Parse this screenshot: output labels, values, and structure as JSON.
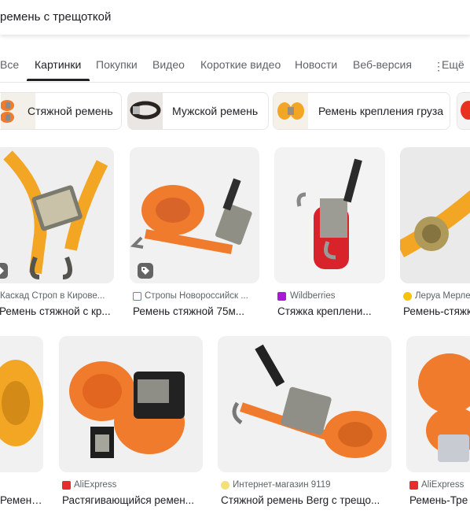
{
  "search": {
    "query": "ремень с трещоткой"
  },
  "tabs": [
    {
      "label": "Все"
    },
    {
      "label": "Картинки"
    },
    {
      "label": "Покупки"
    },
    {
      "label": "Видео"
    },
    {
      "label": "Короткие видео"
    },
    {
      "label": "Новости"
    },
    {
      "label": "Веб-версия"
    },
    {
      "label": "Ещё"
    }
  ],
  "chips": [
    {
      "label": "Стяжной ремень"
    },
    {
      "label": "Мужской ремень"
    },
    {
      "label": "Ремень крепления груза"
    }
  ],
  "row1": [
    {
      "source": "Каскад Строп в Кирове...",
      "title": "Ремень стяжной с кр..."
    },
    {
      "source": "Стропы Новороссийск ...",
      "title": "Ремень стяжной 75м..."
    },
    {
      "source": "Wildberries",
      "title": "Стяжка креплени..."
    },
    {
      "source": "Леруа Мерле",
      "title": "Ремень-стяжк"
    }
  ],
  "row2": [
    {
      "source": "",
      "title": "Ремень ..."
    },
    {
      "source": "AliExpress",
      "title": "Растягивающийся ремен..."
    },
    {
      "source": "Интернет-магазин 9119",
      "title": "Стяжной ремень Berg с трещо..."
    },
    {
      "source": "AliExpress",
      "title": "Ремень-Тре"
    }
  ],
  "colors": {
    "accent": "#202124",
    "strap_orange": "#f07b2c",
    "strap_yellow": "#f2a623"
  },
  "icons": {
    "more": "vertical-dots-icon",
    "shopping": "tag-icon"
  }
}
